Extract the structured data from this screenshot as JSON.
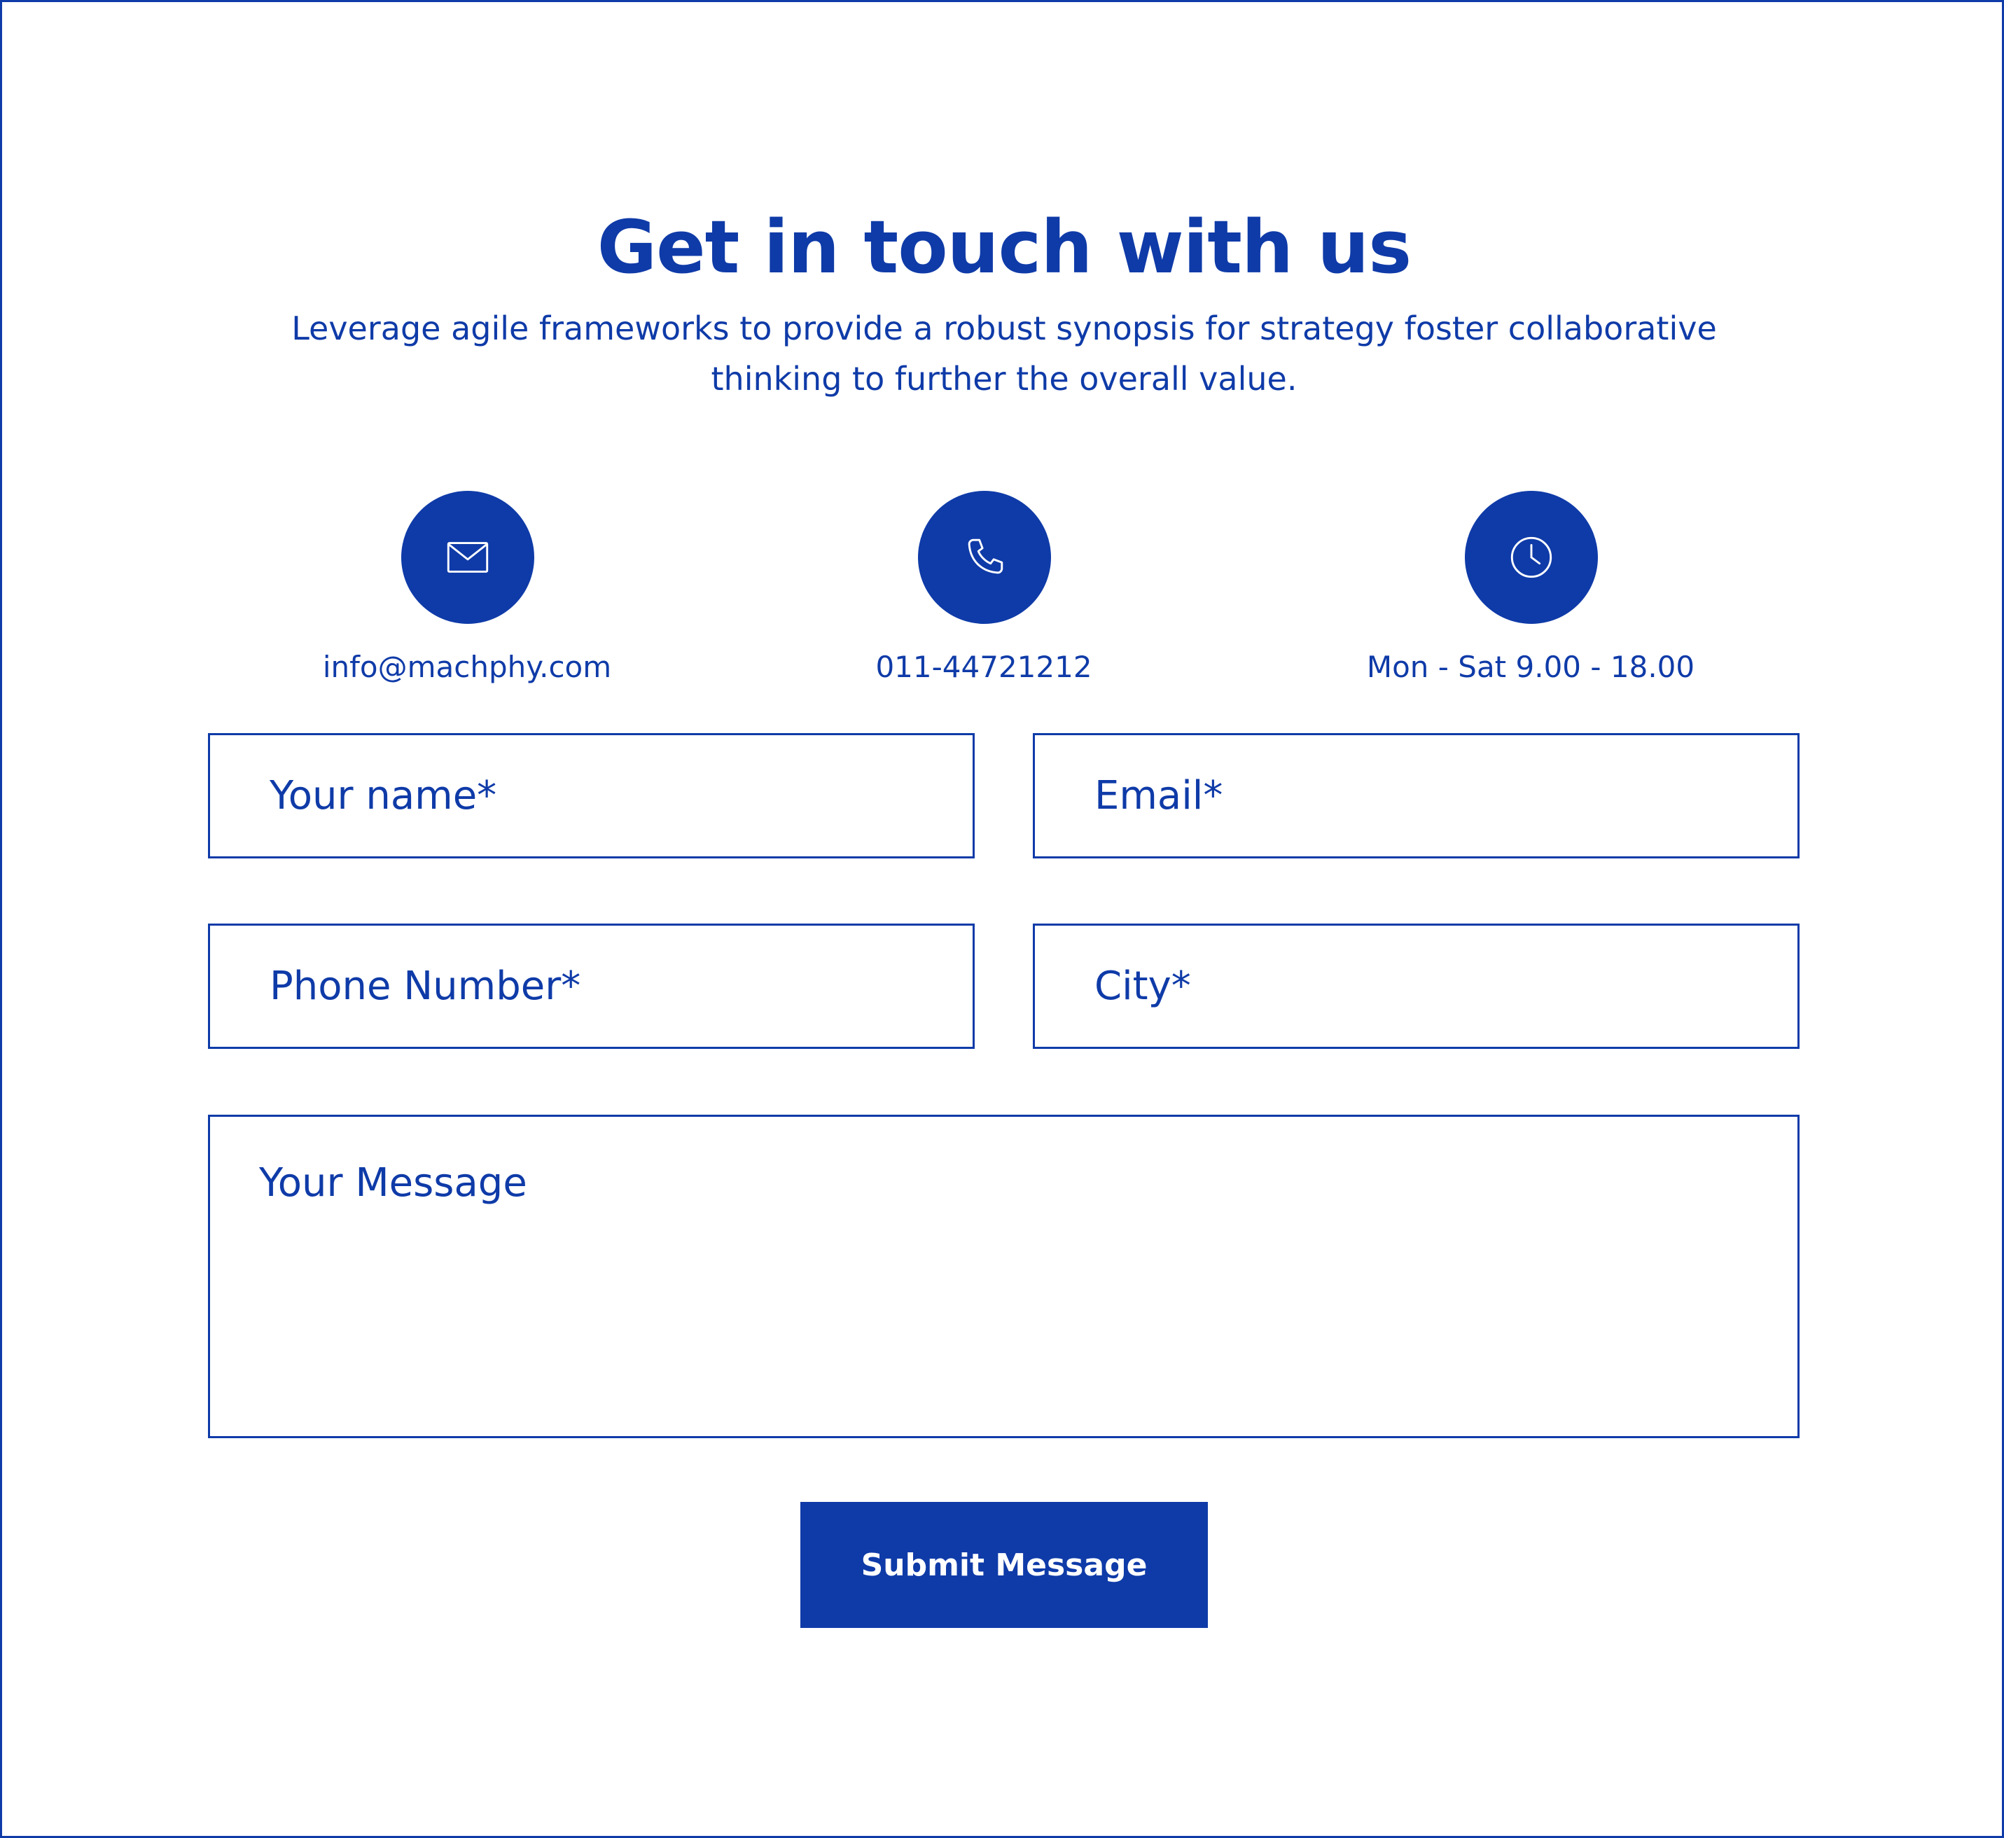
{
  "header": {
    "title": "Get in touch with us",
    "subtitle": "Leverage agile frameworks to provide a robust synopsis for strategy foster collaborative thinking to further the overall value."
  },
  "contact_info": [
    {
      "icon": "envelope-icon",
      "text": "info@machphy.com"
    },
    {
      "icon": "phone-icon",
      "text": "011-44721212"
    },
    {
      "icon": "clock-icon",
      "text": "Mon - Sat 9.00 - 18.00"
    }
  ],
  "form": {
    "name_placeholder": "Your name*",
    "email_placeholder": "Email*",
    "phone_placeholder": "Phone Number*",
    "city_placeholder": "City*",
    "message_placeholder": "Your Message",
    "submit_label": "Submit Message"
  },
  "colors": {
    "accent": "#0f3ba8",
    "background": "#ffffff"
  }
}
